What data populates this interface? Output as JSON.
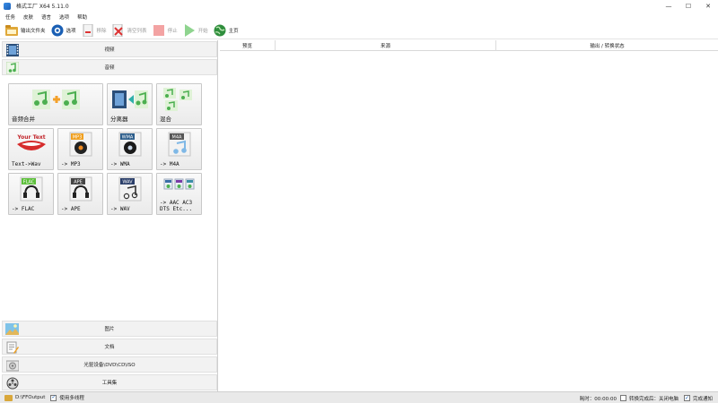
{
  "window": {
    "title": "格式工厂 X64 5.11.0",
    "controls": [
      "—",
      "☐",
      "✕"
    ]
  },
  "menu": [
    "任务",
    "皮肤",
    "语言",
    "选项",
    "帮助"
  ],
  "toolbar": {
    "output_folder": "输出文件夹",
    "options": "选项",
    "remove": "移除",
    "clear_list": "清空列表",
    "stop": "停止",
    "start": "开始",
    "home": "主页"
  },
  "categories": {
    "video": "视频",
    "audio": "音频",
    "image": "图片",
    "document": "文档",
    "rom": "光驱设备\\DVD\\CD\\ISO",
    "toolset": "工具集"
  },
  "tiles": [
    {
      "label": "音频合并"
    },
    {
      "label": "分离器"
    },
    {
      "label": "混合"
    },
    {
      "label": "Text->Wav"
    },
    {
      "label": "-> MP3"
    },
    {
      "label": "-> WMA"
    },
    {
      "label": "-> M4A"
    },
    {
      "label": "-> FLAC"
    },
    {
      "label": "-> APE"
    },
    {
      "label": "-> WAV"
    },
    {
      "label": "-> AAC AC3\nDTS Etc..."
    }
  ],
  "tile_badges": {
    "text_art": "Your Text",
    "mp3": "MP3",
    "wma": "WMA",
    "m4a": "M4A",
    "flac": "FLAC",
    "ape": "APE",
    "wav": "WAV"
  },
  "grid": {
    "columns": [
      "预览",
      "来源",
      "输出 / 转换状态"
    ]
  },
  "status": {
    "output_path": "D:\\FFOutput",
    "multithread": "使用多线程",
    "elapsed": "耗时：00:00:00",
    "shutdown": "转换完成后：关闭电脑",
    "notify": "完成通知"
  },
  "colors": {
    "accent": "#1a5fb4",
    "green_note": "#4caf50",
    "play_green": "#56c15a"
  }
}
